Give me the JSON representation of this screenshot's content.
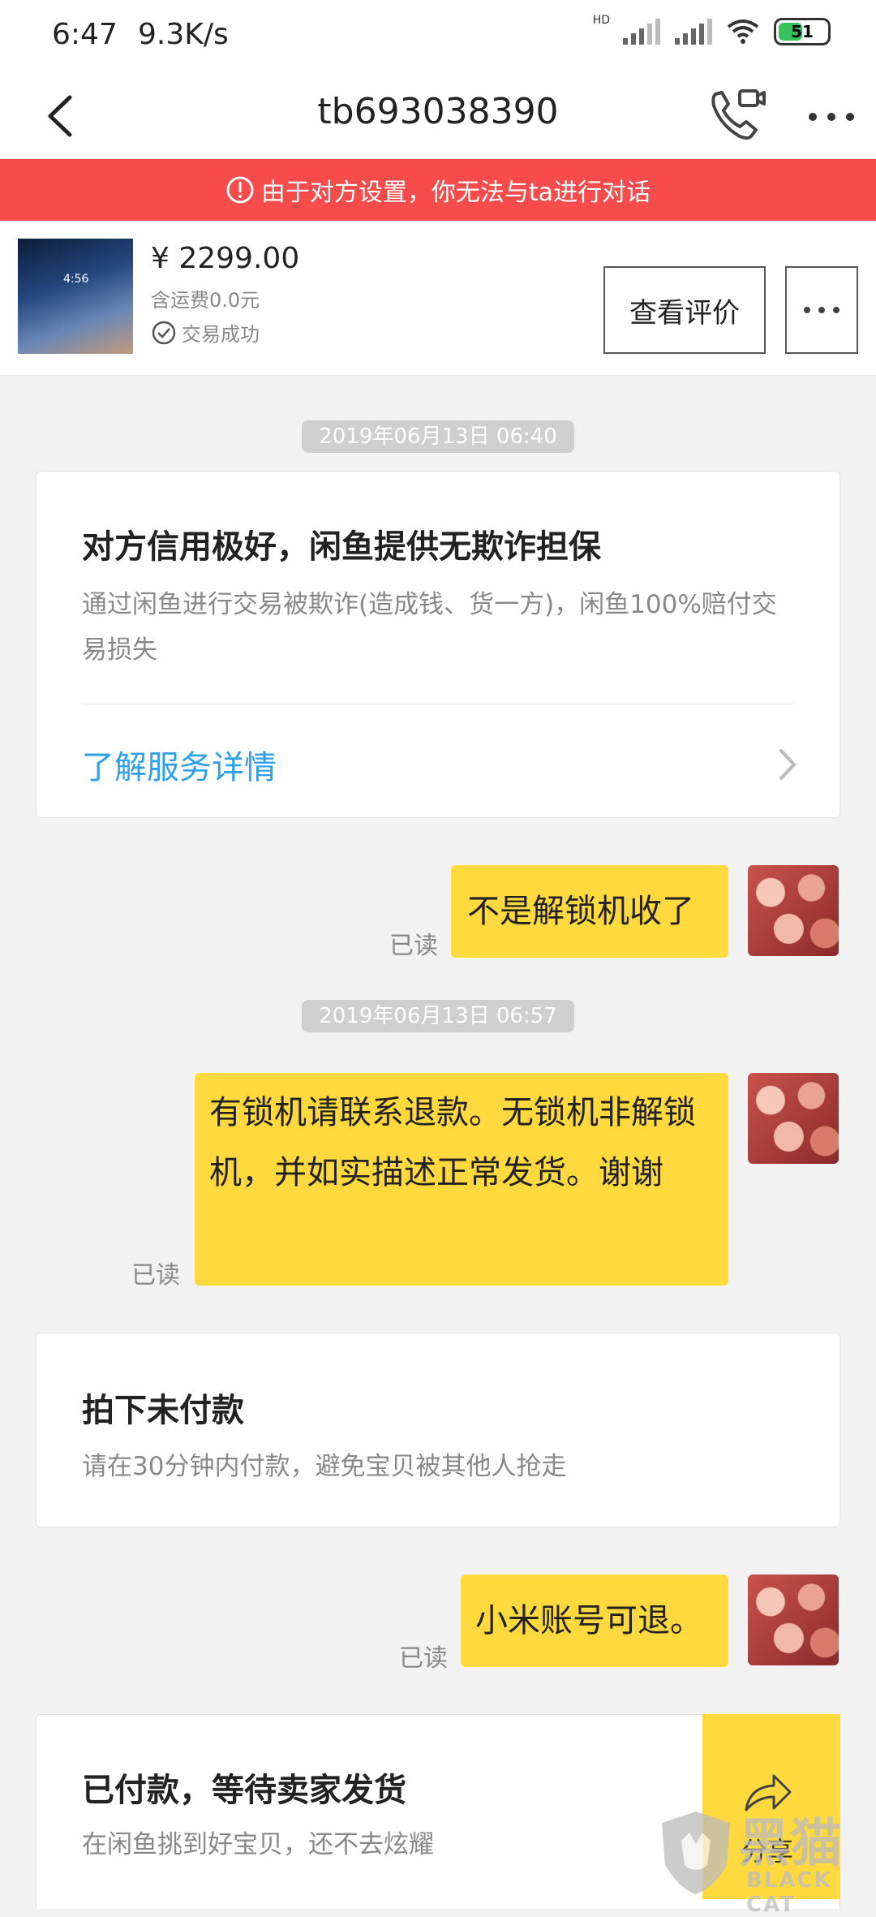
{
  "status_bar": {
    "time": "6:47",
    "speed": "9.3K/s",
    "signal_label": "HD",
    "battery": "51",
    "battery_color": "#38c25b"
  },
  "header": {
    "title": "tb693038390"
  },
  "warning": {
    "text": "由于对方设置，你无法与ta进行对话",
    "color": "#f84b4b"
  },
  "product": {
    "price": "¥ 2299.00",
    "shipping": "含运费0.0元",
    "status": "交易成功",
    "review_button": "查看评价",
    "thumb_time": "4:56"
  },
  "messages": {
    "timestamp_1": "2019年06月13日 06:40",
    "guarantee_card": {
      "title": "对方信用极好，闲鱼提供无欺诈担保",
      "desc": "通过闲鱼进行交易被欺诈(造成钱、货一方)，闲鱼100%赔付交易损失",
      "link": "了解服务详情"
    },
    "msg_1": {
      "text": "不是解锁机收了",
      "read": "已读"
    },
    "timestamp_2": "2019年06月13日 06:57",
    "msg_2": {
      "text": "有锁机请联系退款。无锁机非解锁机，并如实描述正常发货。谢谢",
      "read": "已读"
    },
    "unpaid_card": {
      "title": "拍下未付款",
      "desc": "请在30分钟内付款，避免宝贝被其他人抢走"
    },
    "msg_3": {
      "text": "小米账号可退。",
      "read": "已读"
    },
    "paid_card": {
      "title": "已付款，等待卖家发货",
      "desc": "在闲鱼挑到好宝贝，还不去炫耀",
      "share": "分享"
    }
  },
  "watermark": {
    "zh": "黑猫",
    "en": "BLACK CAT"
  },
  "colors": {
    "bubble": "#ffd93d",
    "link": "#2ea0ea"
  }
}
